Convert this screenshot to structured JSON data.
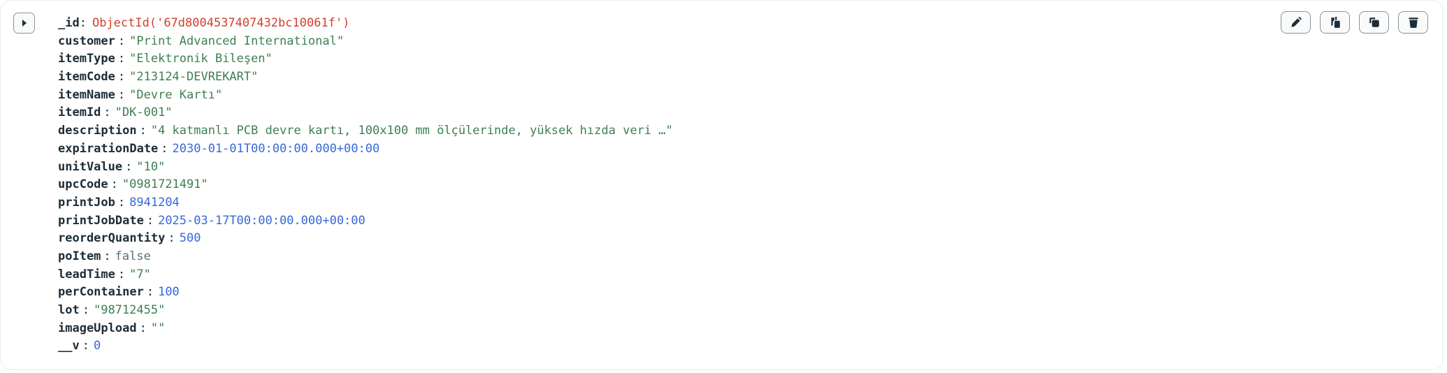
{
  "document": {
    "fields": [
      {
        "key": "_id",
        "value": "ObjectId('67d8004537407432bc10061f')",
        "type": "oid"
      },
      {
        "key": "customer",
        "value": "\"Print Advanced International\"",
        "type": "string"
      },
      {
        "key": "itemType",
        "value": "\"Elektronik Bileşen\"",
        "type": "string"
      },
      {
        "key": "itemCode",
        "value": "\"213124-DEVREKART\"",
        "type": "string"
      },
      {
        "key": "itemName",
        "value": "\"Devre Kartı\"",
        "type": "string"
      },
      {
        "key": "itemId",
        "value": "\"DK-001\"",
        "type": "string"
      },
      {
        "key": "description",
        "value": "\"4 katmanlı PCB devre kartı, 100x100 mm ölçülerinde, yüksek hızda veri …\"",
        "type": "string"
      },
      {
        "key": "expirationDate",
        "value": "2030-01-01T00:00:00.000+00:00",
        "type": "date"
      },
      {
        "key": "unitValue",
        "value": "\"10\"",
        "type": "string"
      },
      {
        "key": "upcCode",
        "value": "\"0981721491\"",
        "type": "string"
      },
      {
        "key": "printJob",
        "value": "8941204",
        "type": "number"
      },
      {
        "key": "printJobDate",
        "value": "2025-03-17T00:00:00.000+00:00",
        "type": "date"
      },
      {
        "key": "reorderQuantity",
        "value": "500",
        "type": "number"
      },
      {
        "key": "poItem",
        "value": "false",
        "type": "bool"
      },
      {
        "key": "leadTime",
        "value": "\"7\"",
        "type": "string"
      },
      {
        "key": "perContainer",
        "value": "100",
        "type": "number"
      },
      {
        "key": "lot",
        "value": "\"98712455\"",
        "type": "string"
      },
      {
        "key": "imageUpload",
        "value": "\"\"",
        "type": "string"
      },
      {
        "key": "__v",
        "value": "0",
        "type": "number"
      }
    ]
  },
  "actions": [
    {
      "name": "edit-document-button",
      "icon": "pencil-icon"
    },
    {
      "name": "copy-document-button",
      "icon": "copy-icon"
    },
    {
      "name": "clone-document-button",
      "icon": "clone-icon"
    },
    {
      "name": "delete-document-button",
      "icon": "trash-icon"
    }
  ]
}
